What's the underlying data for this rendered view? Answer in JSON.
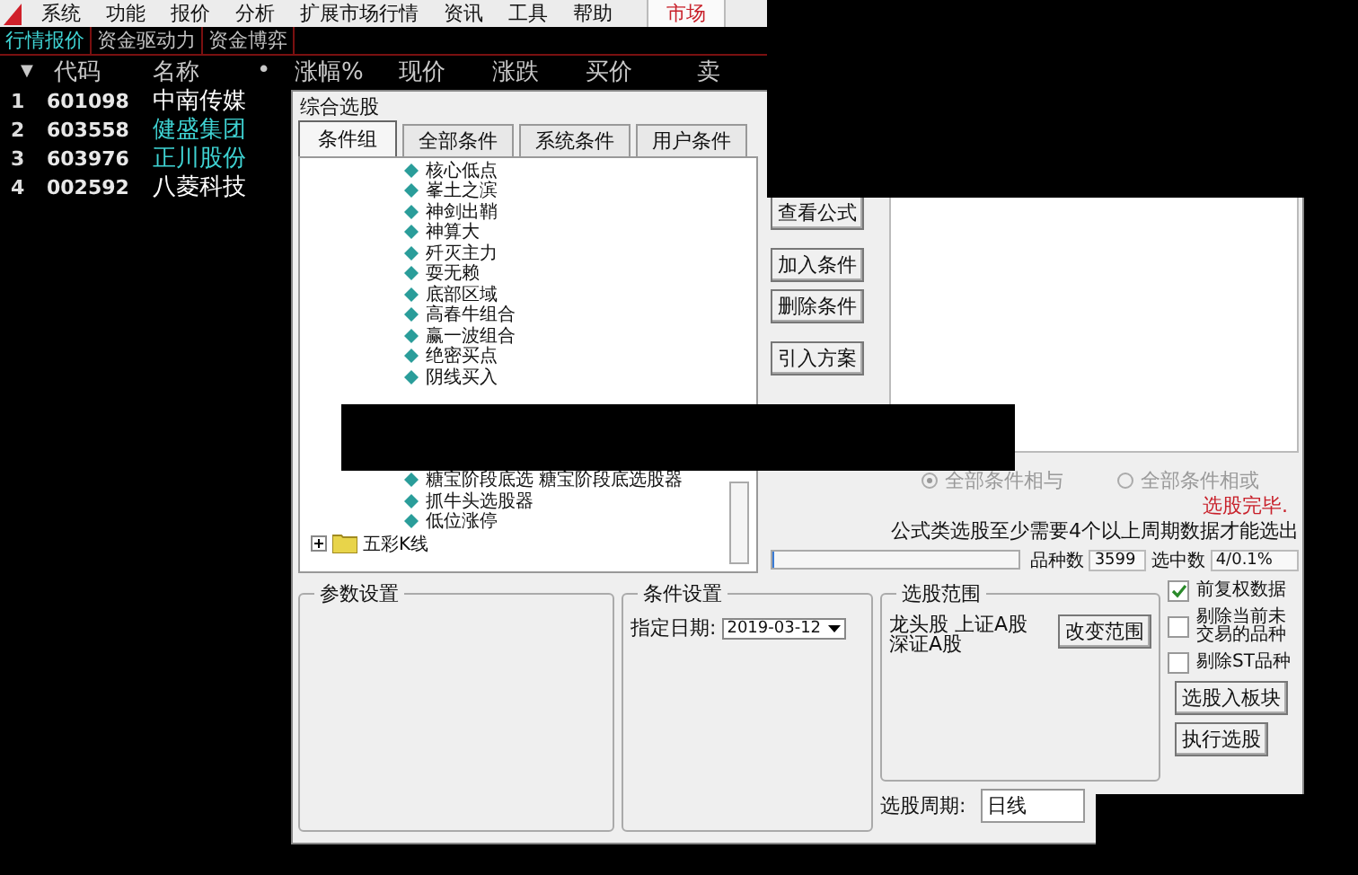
{
  "menu_bar": {
    "items": [
      "系统",
      "功能",
      "报价",
      "分析",
      "扩展市场行情",
      "资讯",
      "工具",
      "帮助"
    ],
    "market_tab": "市场"
  },
  "sub_tabs": [
    {
      "label": "行情报价",
      "selected": true
    },
    {
      "label": "资金驱动力",
      "selected": false
    },
    {
      "label": "资金博弈",
      "selected": false
    }
  ],
  "quote_table": {
    "columns": [
      "▼",
      "代码",
      "名称",
      "•",
      "涨幅%",
      "现价",
      "涨跌",
      "买价",
      "卖"
    ],
    "rows": [
      {
        "index": "1",
        "code": "601098",
        "name": "中南传媒",
        "color": "#ffffff"
      },
      {
        "index": "2",
        "code": "603558",
        "name": "健盛集团",
        "color": "#3fd3d3"
      },
      {
        "index": "3",
        "code": "603976",
        "name": "正川股份",
        "color": "#3fd3d3"
      },
      {
        "index": "4",
        "code": "002592",
        "name": "八菱科技",
        "color": "#ffffff"
      }
    ]
  },
  "dialog": {
    "title": "综合选股",
    "tabs": [
      {
        "label": "条件组",
        "selected": true
      },
      {
        "label": "全部条件",
        "selected": false
      },
      {
        "label": "系统条件",
        "selected": false
      },
      {
        "label": "用户条件",
        "selected": false
      }
    ],
    "tree": [
      {
        "kind": "formula",
        "label": "核心低点"
      },
      {
        "kind": "formula",
        "label": "峯土之滨"
      },
      {
        "kind": "formula",
        "label": "神剑出鞘"
      },
      {
        "kind": "formula",
        "label": "神算大"
      },
      {
        "kind": "formula",
        "label": "歼灭主力"
      },
      {
        "kind": "formula",
        "label": "耍无赖"
      },
      {
        "kind": "formula",
        "label": "底部区域"
      },
      {
        "kind": "formula",
        "label": "高春牛组合"
      },
      {
        "kind": "formula",
        "label": "赢一波组合"
      },
      {
        "kind": "formula",
        "label": "绝密买点"
      },
      {
        "kind": "formula",
        "label": "阴线买入"
      },
      {
        "kind": "gap"
      },
      {
        "kind": "formula",
        "label": "糖宝阶段底选 糖宝阶段底选股器"
      },
      {
        "kind": "formula",
        "label": "抓牛头选股器"
      },
      {
        "kind": "formula",
        "label": "低位涨停"
      },
      {
        "kind": "folder",
        "label": "五彩K线",
        "expanded": false
      }
    ],
    "side_button_groups": [
      [
        "查看公式"
      ],
      [
        "加入条件",
        "删除条件"
      ],
      [
        "引入方案"
      ]
    ],
    "radios": [
      {
        "label": "全部条件相与",
        "selected": true
      },
      {
        "label": "全部条件相或",
        "selected": false
      }
    ],
    "status": "选股完毕.",
    "note": "公式类选股至少需要4个以上周期数据才能选出",
    "progress": {
      "level": 0
    },
    "stats": {
      "count_label": "品种数",
      "count": "3599",
      "selected_label": "选中数",
      "selected": "4/0.1%"
    },
    "param_group": {
      "title": "参数设置"
    },
    "condition_group": {
      "title": "条件设置",
      "date_label": "指定日期:",
      "date": "2019-03-12"
    },
    "range_group": {
      "title": "选股范围",
      "lines": [
        "龙头股 上证A股",
        "深证A股"
      ],
      "button": "改变范围"
    },
    "period": {
      "label": "选股周期:",
      "value": "日线"
    },
    "checkboxes": [
      {
        "label": "前复权数据",
        "checked": true
      },
      {
        "label": "剔除当前未交易的品种",
        "checked": false
      },
      {
        "label": "剔除ST品种",
        "checked": false
      }
    ],
    "action_buttons": [
      "选股入板块",
      "执行选股"
    ]
  }
}
